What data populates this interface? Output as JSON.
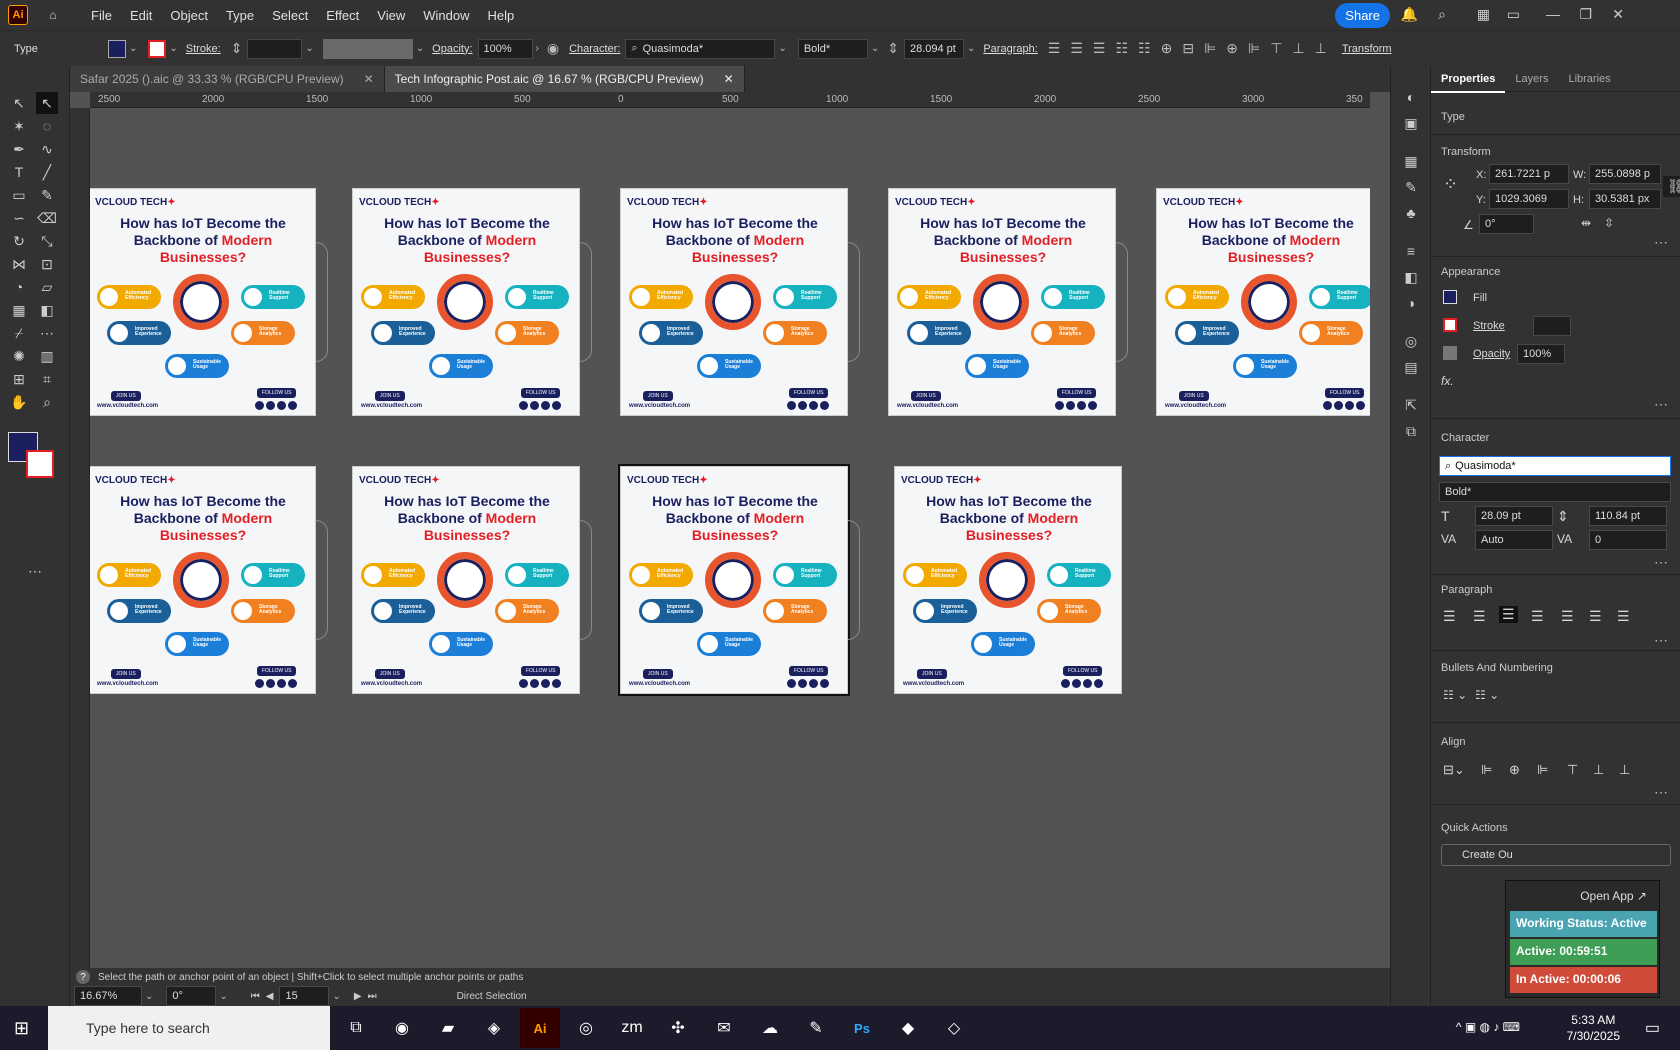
{
  "app": {
    "logo": "Ai",
    "menus": [
      "File",
      "Edit",
      "Object",
      "Type",
      "Select",
      "Effect",
      "View",
      "Window",
      "Help"
    ],
    "share": "Share"
  },
  "control": {
    "mode": "Type",
    "stroke_label": "Stroke:",
    "opacity_label": "Opacity:",
    "opacity": "100%",
    "character_label": "Character:",
    "font": "Quasimoda*",
    "style": "Bold*",
    "size": "28.094 pt",
    "paragraph_label": "Paragraph:",
    "transform": "Transform"
  },
  "tabs": [
    {
      "label": "Safar 2025 ().aic @ 33.33 % (RGB/CPU Preview)"
    },
    {
      "label": "Tech Infographic Post.aic @ 16.67 % (RGB/CPU Preview)"
    }
  ],
  "ruler": [
    "2500",
    "2000",
    "1500",
    "1000",
    "500",
    "0",
    "500",
    "1000",
    "1500",
    "2000",
    "2500",
    "3000",
    "350"
  ],
  "artboard": {
    "brand": "VCLOUD TECH",
    "heading1": "How has IoT Become the",
    "heading2": "Backbone of",
    "heading2red": "Modern",
    "heading3": "Businesses?",
    "p1": "Automated Efficiency",
    "p2": "Realtime Support",
    "p3": "Improved Experience",
    "p4": "Storage Analytics",
    "p5": "Sustainable Usage",
    "join": "JOIN US",
    "follow": "FOLLOW US",
    "url": "www.vcloudtech.com"
  },
  "panel": {
    "tabs": [
      "Properties",
      "Layers",
      "Libraries"
    ],
    "type": "Type",
    "transform": "Transform",
    "x_label": "X:",
    "x": "261.7221 p",
    "y_label": "Y:",
    "y": "1029.3069",
    "w_label": "W:",
    "w": "255.0898 p",
    "h_label": "H:",
    "h": "30.5381 px",
    "angle": "0°",
    "appearance": "Appearance",
    "fill": "Fill",
    "stroke": "Stroke",
    "opacity": "Opacity",
    "opacity_val": "100%",
    "fx": "fx.",
    "character": "Character",
    "font": "Quasimoda*",
    "style": "Bold*",
    "size": "28.09 pt",
    "leading": "110.84 pt",
    "kerning": "Auto",
    "tracking": "0",
    "paragraph": "Paragraph",
    "bullets": "Bullets And Numbering",
    "align": "Align",
    "quick": "Quick Actions",
    "create": "Create Ou",
    "open_app": "Open App ↗"
  },
  "widget": {
    "status": "Working Status: Active",
    "active": "Active: 00:59:51",
    "inactive": "In Active: 00:00:06"
  },
  "status": {
    "hint": "Select the path or anchor point of an object  |  Shift+Click to select multiple anchor points or paths",
    "zoom": "16.67%",
    "rotate": "0°",
    "page": "15",
    "tool": "Direct Selection"
  },
  "taskbar": {
    "search": "Type here to search",
    "time": "5:33 AM",
    "date": "7/30/2025"
  },
  "colors": {
    "accent": "#1473e6",
    "navy": "#1a1f5e",
    "red": "#e31e24"
  }
}
